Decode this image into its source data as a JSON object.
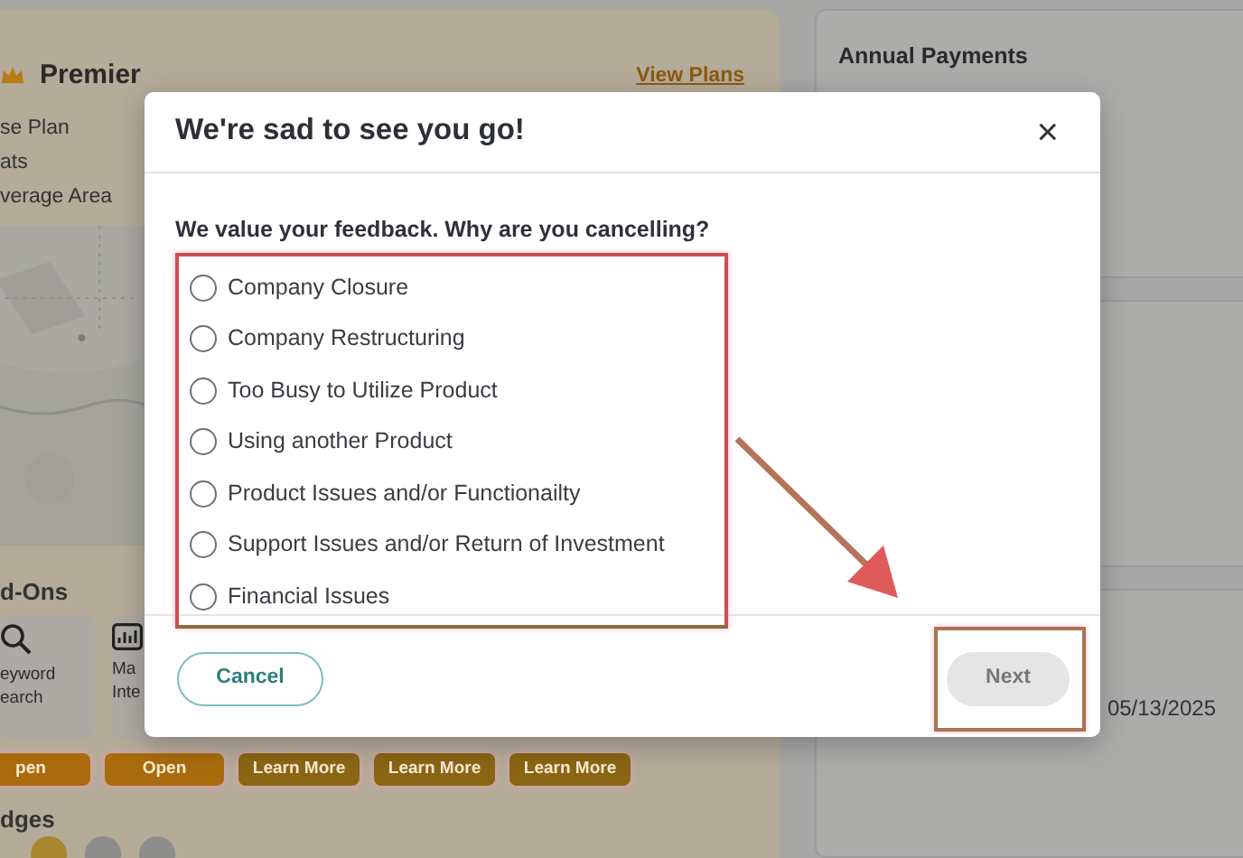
{
  "plan_card": {
    "title": "Premier",
    "link": "View Plans",
    "features": [
      "se Plan",
      "ats",
      "verage Area"
    ],
    "addons_heading": "d-Ons",
    "addons": [
      {
        "kind": "search",
        "lines": [
          "eyword",
          "earch"
        ]
      },
      {
        "kind": "chart",
        "lines": [
          "Ma",
          "Inte"
        ]
      }
    ],
    "addon_buttons": [
      {
        "label": "pen",
        "kind": "open"
      },
      {
        "label": "Open",
        "kind": "open"
      },
      {
        "label": "Learn More",
        "kind": "learn"
      },
      {
        "label": "Learn More",
        "kind": "learn"
      },
      {
        "label": "Learn More",
        "kind": "learn"
      }
    ],
    "badges_heading": "dges"
  },
  "side_cards": [
    {
      "kind": "titled",
      "title": "Annual Payments"
    },
    {
      "kind": "blank"
    },
    {
      "kind": "dated",
      "text": "05/13/2025"
    }
  ],
  "modal": {
    "title": "We're sad to see you go!",
    "close": "×",
    "question": "We value your feedback. Why are you cancelling?",
    "options": [
      {
        "label": "Company Closure",
        "selected": false
      },
      {
        "label": "Company Restructuring",
        "selected": false
      },
      {
        "label": "Too Busy to Utilize Product",
        "selected": false
      },
      {
        "label": "Using another Product",
        "selected": false
      },
      {
        "label": "Product Issues and/or Functionailty",
        "selected": false
      },
      {
        "label": "Support Issues and/or Return of Investment",
        "selected": false
      },
      {
        "label": "Financial Issues",
        "selected": false
      }
    ],
    "buttons": [
      {
        "label": "Cancel",
        "kind": "outline",
        "disabled": false
      },
      {
        "label": "Next",
        "kind": "solid",
        "disabled": true
      }
    ]
  }
}
